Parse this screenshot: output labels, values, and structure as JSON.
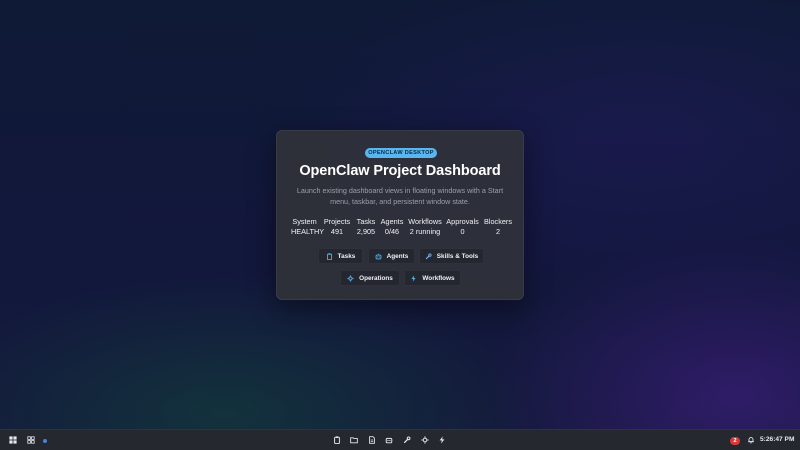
{
  "card": {
    "badge": "OPENCLAW DESKTOP",
    "title": "OpenClaw Project Dashboard",
    "subtitle": "Launch existing dashboard views in floating windows with a Start menu, taskbar, and persistent window state."
  },
  "stats": [
    {
      "label": "System",
      "value": "HEALTHY"
    },
    {
      "label": "Projects",
      "value": "491"
    },
    {
      "label": "Tasks",
      "value": "2,905"
    },
    {
      "label": "Agents",
      "value": "0/46"
    },
    {
      "label": "Workflows",
      "value": "2 running"
    },
    {
      "label": "Approvals",
      "value": "0"
    },
    {
      "label": "Blockers",
      "value": "2"
    }
  ],
  "buttons": {
    "tasks": "Tasks",
    "agents": "Agents",
    "skills": "Skills & Tools",
    "operations": "Operations",
    "workflows": "Workflows"
  },
  "taskbar": {
    "notification_count": "2",
    "clock": "5:26:47 PM"
  },
  "colors": {
    "accent": "#58b7ef",
    "notification": "#d63a3a",
    "active_dot": "#4f7fd8"
  }
}
